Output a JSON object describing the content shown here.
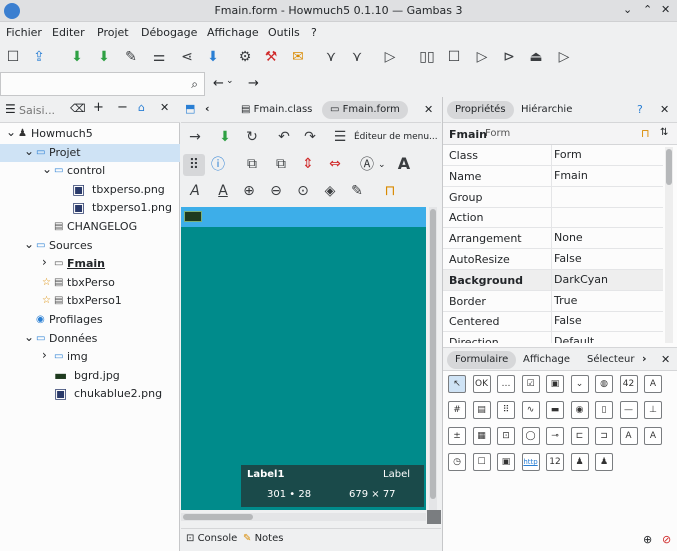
{
  "window": {
    "title": "Fmain.form - Howmuch5 0.1.10 — Gambas 3"
  },
  "menu": [
    "Fichier",
    "Editer",
    "Projet",
    "Débogage",
    "Affichage",
    "Outils",
    "?"
  ],
  "search": {
    "placeholder": "Saisi..."
  },
  "tree": [
    {
      "label": "Howmuch5",
      "level": 0,
      "arrow": "v",
      "icon": "app"
    },
    {
      "label": "Projet",
      "level": 1,
      "arrow": "v",
      "icon": "folder",
      "selected": true
    },
    {
      "label": "control",
      "level": 2,
      "arrow": "v",
      "icon": "folder"
    },
    {
      "label": "tbxperso.png",
      "level": 3,
      "icon": "image"
    },
    {
      "label": "tbxperso1.png",
      "level": 3,
      "icon": "image"
    },
    {
      "label": "CHANGELOG",
      "level": 2,
      "icon": "file"
    },
    {
      "label": "Sources",
      "level": 1,
      "arrow": "v",
      "icon": "folder"
    },
    {
      "label": "Fmain",
      "level": 2,
      "arrow": ">",
      "icon": "form",
      "bold": true
    },
    {
      "label": "tbxPerso",
      "level": 2,
      "icon": "class",
      "star": true
    },
    {
      "label": "tbxPerso1",
      "level": 2,
      "icon": "class",
      "star": true
    },
    {
      "label": "Profilages",
      "level": 1,
      "icon": "profile"
    },
    {
      "label": "Données",
      "level": 1,
      "arrow": "v",
      "icon": "folder"
    },
    {
      "label": "img",
      "level": 2,
      "arrow": ">",
      "icon": "folder"
    },
    {
      "label": "bgrd.jpg",
      "level": 2,
      "icon": "thumb"
    },
    {
      "label": "chukablue2.png",
      "level": 2,
      "icon": "image"
    }
  ],
  "editor_tabs": [
    {
      "label": "Fmain.class",
      "active": false
    },
    {
      "label": "Fmain.form",
      "active": true
    }
  ],
  "menu_editor": "Éditeur de menu...",
  "selection": {
    "name": "Label1",
    "type": "Label",
    "pos": "301 • 28",
    "size": "679 × 77"
  },
  "bottom": {
    "console": "Console",
    "notes": "Notes"
  },
  "right_tabs": {
    "props": "Propriétés",
    "hier": "Hiérarchie",
    "help": "?"
  },
  "obj": {
    "name": "Fmain",
    "type": "Form"
  },
  "props": [
    {
      "k": "Class",
      "v": "Form"
    },
    {
      "k": "Name",
      "v": "Fmain"
    },
    {
      "k": "Group",
      "v": ""
    },
    {
      "k": "Action",
      "v": ""
    },
    {
      "k": "Arrangement",
      "v": "None"
    },
    {
      "k": "AutoResize",
      "v": "False"
    },
    {
      "k": "Background",
      "v": "DarkCyan",
      "bold": true
    },
    {
      "k": "Border",
      "v": "True"
    },
    {
      "k": "Centered",
      "v": "False"
    },
    {
      "k": "Direction",
      "v": "Default"
    }
  ],
  "toolbox_tabs": {
    "form": "Formulaire",
    "display": "Affichage",
    "sel": "Sélecteur"
  },
  "colors": {
    "canvas": "#008b8b",
    "accent": "#3daee9",
    "selected_row": "#cfe3f5"
  }
}
